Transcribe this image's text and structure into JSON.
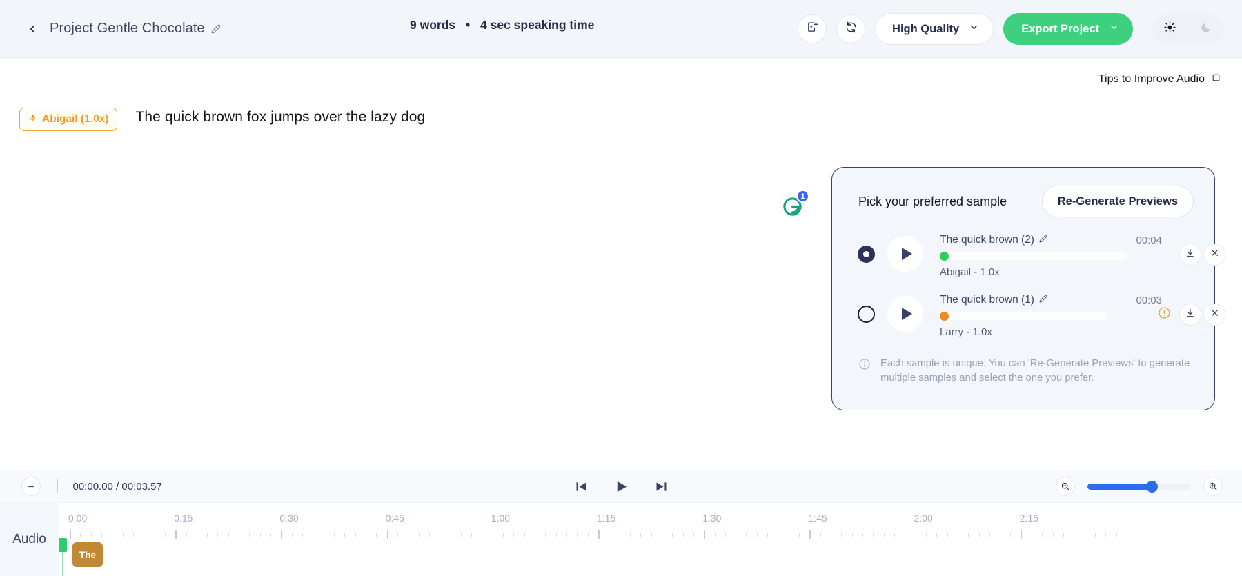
{
  "header": {
    "back_icon": "chevron-left-icon",
    "project_title": "Project Gentle Chocolate",
    "edit_icon": "pencil-edit-icon",
    "meta_words": "9 words",
    "meta_separator": "•",
    "meta_time": "4 sec speaking time",
    "add_media_icon": "add-media-icon",
    "regenerate_icon": "refresh-circle-icon",
    "quality_label": "High Quality",
    "quality_chevron": "chevron-down-icon",
    "export_label": "Export Project",
    "export_chevron": "chevron-down-icon",
    "export_color": "#3dd17f",
    "theme_light_icon": "sun-icon",
    "theme_dark_icon": "moon-icon"
  },
  "main": {
    "tips_label": "Tips to Improve Audio",
    "tips_icon": "external-window-icon",
    "voice_tag": "Abigail (1.0x)",
    "voice_tag_icon": "microphone-icon",
    "voice_tag_color": "#e8a020",
    "script_text": "The quick brown fox jumps over the lazy dog",
    "grammarly_icon": "grammarly-g-icon",
    "grammarly_badge": "1"
  },
  "sample_panel": {
    "title": "Pick your preferred sample",
    "regenerate_button": "Re-Generate Previews",
    "note_icon": "info-circle-icon",
    "note_text": "Each sample is unique. You can 'Re-Generate Previews' to generate multiple samples and select the one you prefer.",
    "samples": [
      {
        "selected": true,
        "play_icon": "play-icon",
        "name": "The quick brown (2)",
        "edit_icon": "pencil-edit-icon",
        "duration": "00:04",
        "voice": "Abigail - 1.0x",
        "status_color": "#2ecc5a",
        "has_warning": false,
        "download_icon": "download-icon",
        "remove_icon": "close-x-icon"
      },
      {
        "selected": false,
        "play_icon": "play-icon",
        "name": "The quick brown (1)",
        "edit_icon": "pencil-edit-icon",
        "duration": "00:03",
        "voice": "Larry - 1.0x",
        "status_color": "#ef8b22",
        "has_warning": true,
        "warning_icon": "warning-info-icon",
        "download_icon": "download-icon",
        "remove_icon": "close-x-icon"
      }
    ]
  },
  "timeline": {
    "zoom_out_small_icon": "minus-circle-icon",
    "current_time": "00:00.00",
    "time_separator": "/",
    "total_time": "00:03.57",
    "time_display": "00:00.00 / 00:03.57",
    "skip_back_icon": "skip-previous-icon",
    "play_icon": "play-icon",
    "skip_forward_icon": "skip-next-icon",
    "zoom_out_icon": "zoom-out-icon",
    "zoom_in_icon": "zoom-in-icon",
    "zoom_value": 62,
    "track_label": "Audio",
    "clip_label": "The",
    "clip_color": "#c08a35",
    "playhead_color": "#2ecc71",
    "ruler_ticks": [
      "0:00",
      "0:15",
      "0:30",
      "0:45",
      "1:00",
      "1:15",
      "1:30",
      "1:45",
      "2:00",
      "2:15"
    ]
  }
}
